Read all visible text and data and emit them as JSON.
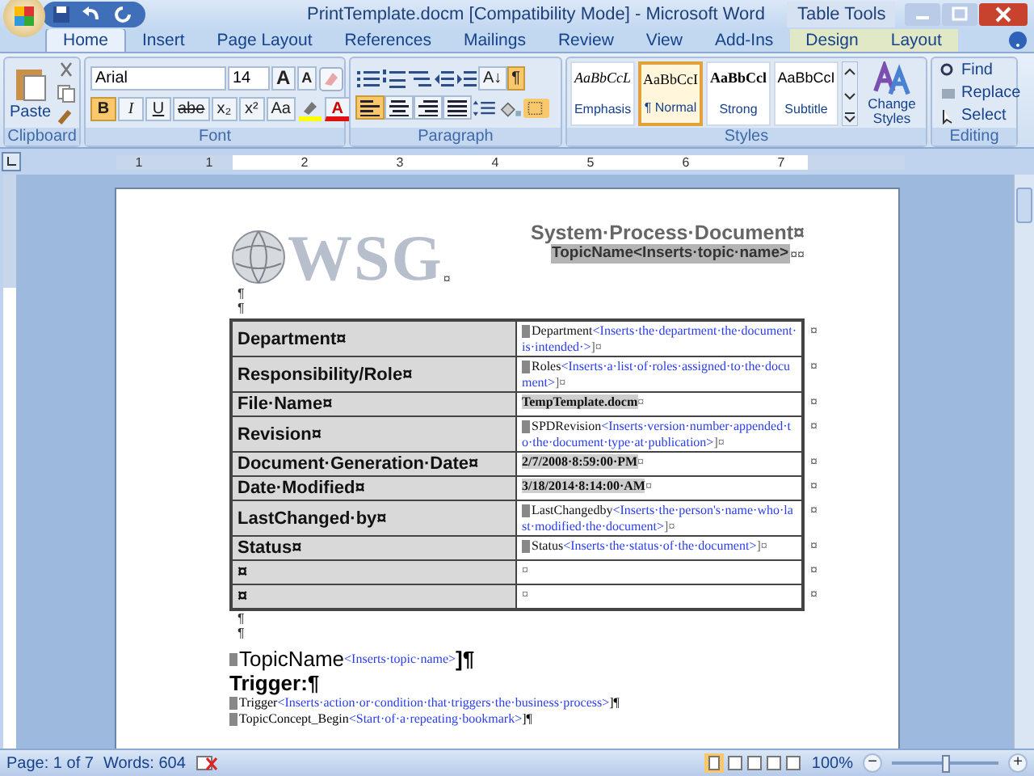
{
  "window": {
    "title": "PrintTemplate.docm [Compatibility Mode] - Microsoft Word",
    "context_group": "Table Tools"
  },
  "tabs": [
    {
      "label": "Home",
      "selected": true,
      "kind": "main"
    },
    {
      "label": "Insert",
      "selected": false,
      "kind": "main"
    },
    {
      "label": "Page Layout",
      "selected": false,
      "kind": "main"
    },
    {
      "label": "References",
      "selected": false,
      "kind": "main"
    },
    {
      "label": "Mailings",
      "selected": false,
      "kind": "main"
    },
    {
      "label": "Review",
      "selected": false,
      "kind": "main"
    },
    {
      "label": "View",
      "selected": false,
      "kind": "main"
    },
    {
      "label": "Add-Ins",
      "selected": false,
      "kind": "main"
    },
    {
      "label": "Design",
      "selected": false,
      "kind": "contextual"
    },
    {
      "label": "Layout",
      "selected": false,
      "kind": "contextual"
    }
  ],
  "ribbon": {
    "clipboard": {
      "label": "Clipboard",
      "paste": "Paste"
    },
    "font": {
      "label": "Font",
      "font_name": "Arial",
      "font_size": "14",
      "grow": "A",
      "shrink": "A",
      "color_letter": "A",
      "buttons": [
        {
          "label": "B",
          "selected": true
        },
        {
          "label": "I",
          "selected": false
        },
        {
          "label": "U",
          "selected": false
        },
        {
          "label": "abe",
          "selected": false
        },
        {
          "label": "x₂",
          "selected": false
        },
        {
          "label": "x²",
          "selected": false
        },
        {
          "label": "Aa",
          "selected": false
        }
      ]
    },
    "paragraph": {
      "label": "Paragraph",
      "show_marks": true,
      "sort_label": "A↓",
      "pilcrow": "¶",
      "align": [
        {
          "selected": true
        },
        {
          "selected": false
        },
        {
          "selected": false
        },
        {
          "selected": false
        }
      ]
    },
    "styles": {
      "label": "Styles",
      "change_styles": "Change Styles",
      "items": [
        {
          "sample": "AaBbCcL",
          "name": "Emphasis",
          "kind": "emphasis",
          "selected": false
        },
        {
          "sample": "AaBbCcI",
          "name": "¶ Normal",
          "kind": "normal",
          "selected": true
        },
        {
          "sample": "AaBbCcl",
          "name": "Strong",
          "kind": "strong",
          "selected": false
        },
        {
          "sample": "AaBbCcI",
          "name": "Subtitle",
          "kind": "subtitle",
          "selected": false
        }
      ]
    },
    "editing": {
      "label": "Editing",
      "items": [
        "Find",
        "Replace",
        "Select"
      ]
    }
  },
  "ruler": {
    "labels": [
      "1",
      "1",
      "2",
      "3",
      "4",
      "5",
      "6",
      "7"
    ]
  },
  "document": {
    "logo": "WSG",
    "title": "System·Process·Document¤",
    "topic": "TopicName<Inserts·topic·name>",
    "marks": [
      "¤",
      "¤",
      "¤"
    ],
    "paragraph_marks": [
      "¶",
      "¶"
    ],
    "table": [
      {
        "label": "Department¤",
        "kind": "field",
        "field": "Department",
        "hint": "<Inserts·the·department·the·document·is·intended·>",
        "end": "]¤",
        "row_end": "¤"
      },
      {
        "label": "Responsibility/Role¤",
        "kind": "field",
        "field": "Roles",
        "hint": "<Inserts·a·list·of·roles·assigned·to·the·document>",
        "end": "]¤",
        "row_end": "¤"
      },
      {
        "label": "File·Name¤",
        "kind": "value",
        "value": "TempTemplate.docm",
        "end": "¤",
        "row_end": "¤"
      },
      {
        "label": "Revision¤",
        "kind": "field",
        "field": "SPDRevision",
        "hint": "<Inserts·version·number·appended·to·the·document·type·at·publication>",
        "end": "]¤",
        "row_end": "¤"
      },
      {
        "label": "Document·Generation·Date¤",
        "kind": "value",
        "value": "2/7/2008·8:59:00·PM",
        "end": "¤",
        "row_end": "¤"
      },
      {
        "label": "Date·Modified¤",
        "kind": "value",
        "value": "3/18/2014·8:14:00·AM",
        "end": "¤",
        "row_end": "¤"
      },
      {
        "label": "LastChanged·by¤",
        "kind": "field",
        "field": "LastChangedby",
        "hint": "<Inserts·the·person's·name·who·last·modified·the·document>",
        "end": "]¤",
        "row_end": "¤"
      },
      {
        "label": "Status¤",
        "kind": "field",
        "field": "Status",
        "hint": "<Inserts·the·status·of·the·document>",
        "end": "]¤",
        "row_end": "¤"
      },
      {
        "label": "¤",
        "kind": "empty",
        "value": "¤",
        "row_end": "¤"
      },
      {
        "label": "¤",
        "kind": "empty",
        "value": "¤",
        "row_end": "¤"
      }
    ],
    "after_marks": [
      "¶",
      "¶"
    ],
    "body": [
      {
        "kind": "heading",
        "field": "TopicName",
        "hint": "<Inserts·topic·name>",
        "end": "]¶"
      },
      {
        "kind": "subheading",
        "text": "Trigger:¶"
      },
      {
        "kind": "field",
        "field": "Trigger",
        "hint": "<Inserts·action·or·condition·that·triggers·the·business·process>",
        "end": "]¶"
      },
      {
        "kind": "field",
        "field": "TopicConcept_Begin",
        "hint": "<Start·of·a·repeating·bookmark>",
        "end": "]¶"
      }
    ]
  },
  "status_bar": {
    "page": "Page: 1 of 7",
    "words": "Words: 604",
    "zoom": "100%",
    "zoom_out": "−",
    "zoom_in": "+",
    "level": 0.5
  }
}
